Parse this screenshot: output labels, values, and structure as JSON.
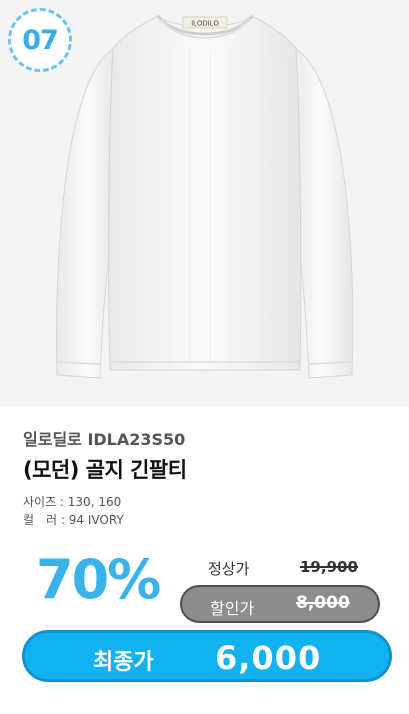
{
  "badge": {
    "number": "07"
  },
  "product": {
    "image_alt": "white ribbed long sleeve t-shirt",
    "tag_text": "ILODILO",
    "brand": "일로딜로 IDLA23S50",
    "title": "(모던) 골지 긴팔티",
    "size_line": "사이즈 : 130, 160",
    "color_line": "컬　러 : 94 IVORY"
  },
  "pricing": {
    "discount": "70%",
    "regular_label": "정상가",
    "regular_price": "19,900",
    "sale_label": "할인가",
    "sale_price": "8,000",
    "final_label": "최종가",
    "final_price": "6,000"
  },
  "colors": {
    "accent_blue": "#3ab3ea",
    "final_pill": "#12b1ef",
    "sale_pill": "#8c8c8c",
    "photo_bg": "#f4f4f4"
  }
}
